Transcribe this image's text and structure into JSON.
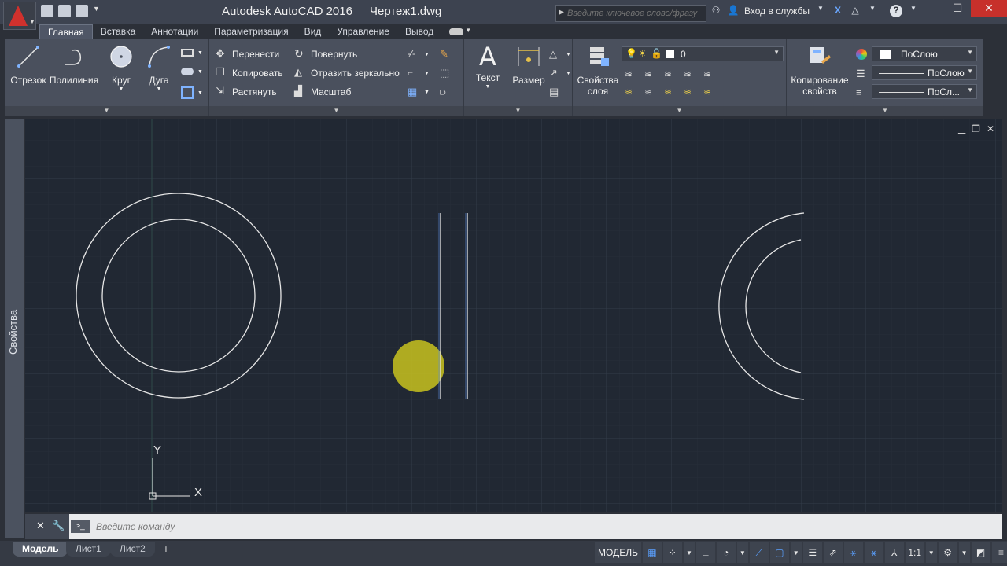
{
  "title": {
    "app": "Autodesk AutoCAD 2016",
    "file": "Чертеж1.dwg",
    "search_placeholder": "Введите ключевое слово/фразу",
    "signin": "Вход в службы",
    "help": "?"
  },
  "tabs": [
    "Главная",
    "Вставка",
    "Аннотации",
    "Параметризация",
    "Вид",
    "Управление",
    "Вывод"
  ],
  "ribbon": {
    "draw": {
      "line": "Отрезок",
      "polyline": "Полилиния",
      "circle": "Круг",
      "arc": "Дуга"
    },
    "modify": {
      "move": "Перенести",
      "rotate": "Повернуть",
      "copy": "Копировать",
      "mirror": "Отразить зеркально",
      "stretch": "Растянуть",
      "scale": "Масштаб"
    },
    "annotation": {
      "text": "Текст",
      "dimension": "Размер"
    },
    "layers": {
      "properties_line1": "Свойства",
      "properties_line2": "слоя",
      "current_layer": "0"
    },
    "properties": {
      "match_line1": "Копирование",
      "match_line2": "свойств",
      "color": "ПоСлою",
      "linetype": "ПоСлою",
      "lineweight": "ПоСл..."
    }
  },
  "palette_label": "Свойства",
  "ucs": {
    "x": "X",
    "y": "Y"
  },
  "command": {
    "placeholder": "Введите команду"
  },
  "layout_tabs": [
    "Модель",
    "Лист1",
    "Лист2"
  ],
  "status": {
    "model": "МОДЕЛЬ",
    "scale": "1:1"
  },
  "colors": {
    "canvas": "#212833",
    "grid": "#2c3542",
    "geometry": "#e6e6e6",
    "cursor_highlight": "#c8c21e"
  }
}
